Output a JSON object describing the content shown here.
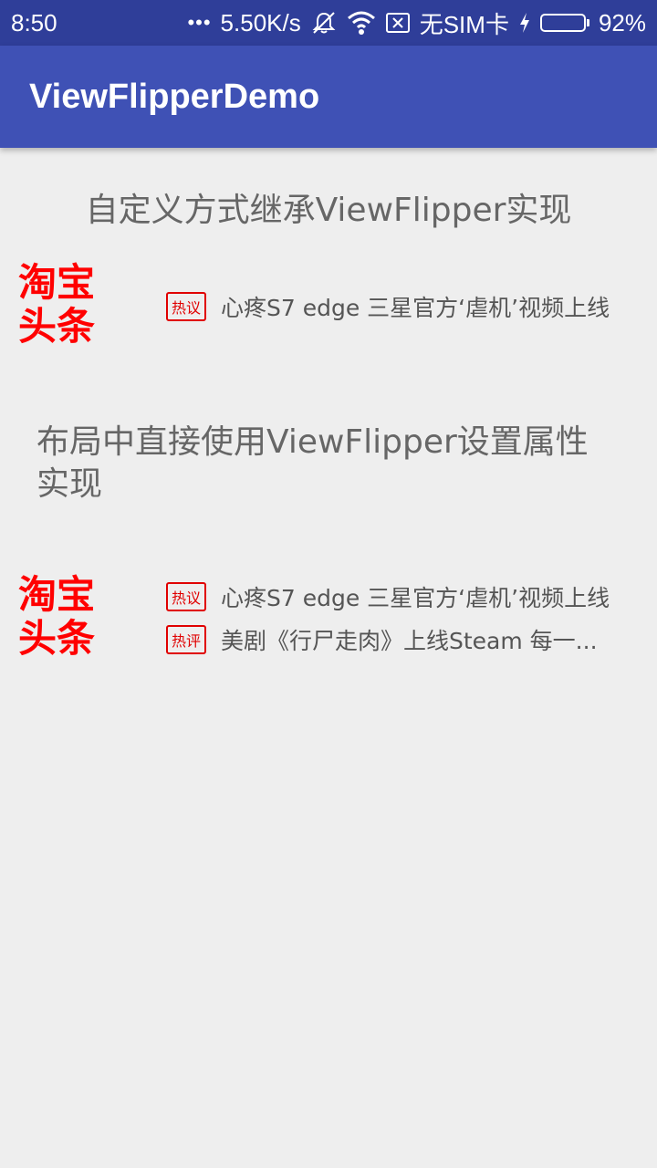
{
  "status_bar": {
    "time": "8:50",
    "dots": "•••",
    "network_speed": "5.50K/s",
    "sim_status": "无SIM卡",
    "battery_percent": "92%",
    "battery_level": 0.92,
    "battery_color": "#4cd964"
  },
  "app_bar": {
    "title": "ViewFlipperDemo",
    "color": "#3f51b5"
  },
  "section1": {
    "title": "自定义方式继承ViewFlipper实现",
    "brand": "淘宝\n头条",
    "items": [
      {
        "tag": "热议",
        "text": "心疼S7 edge 三星官方‘虐机’视频上线"
      }
    ]
  },
  "section2": {
    "title": "布局中直接使用ViewFlipper设置属性实现",
    "brand": "淘宝\n头条",
    "items": [
      {
        "tag": "热议",
        "text": "心疼S7 edge 三星官方‘虐机’视频上线"
      },
      {
        "tag": "热评",
        "text": "美剧《行尸走肉》上线Steam 每一..."
      }
    ]
  },
  "icons": [
    "silent-mode-icon",
    "wifi-icon",
    "no-sim-icon",
    "charging-icon",
    "battery-icon"
  ]
}
